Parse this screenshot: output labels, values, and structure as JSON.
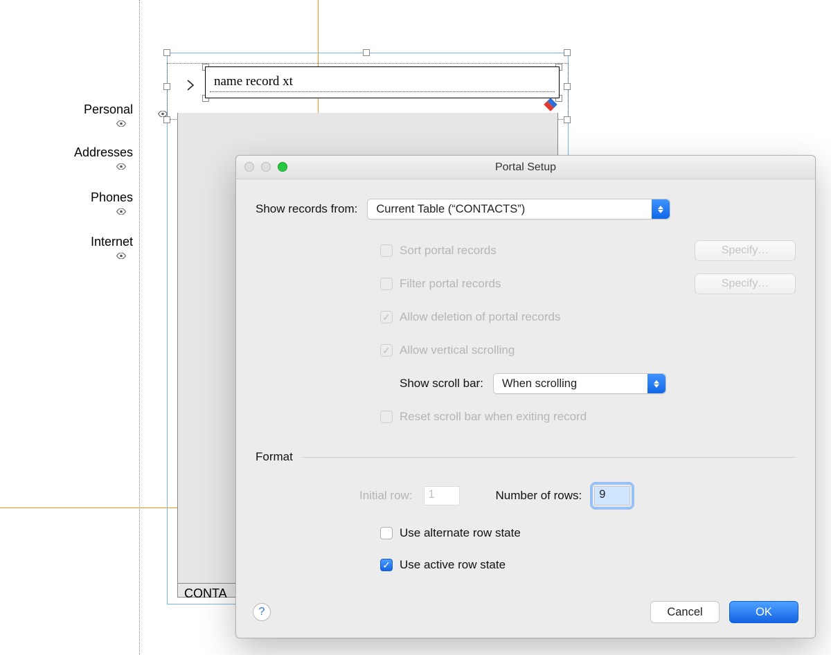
{
  "sidebar": {
    "items": [
      {
        "label": "Personal"
      },
      {
        "label": "Addresses"
      },
      {
        "label": "Phones"
      },
      {
        "label": "Internet"
      }
    ]
  },
  "layout": {
    "field_label": "name record xt",
    "portal_footer": "CONTA"
  },
  "dialog": {
    "title": "Portal Setup",
    "show_records_label": "Show records from:",
    "show_records_value": "Current Table (“CONTACTS”)",
    "sort_label": "Sort portal records",
    "filter_label": "Filter portal records",
    "allow_delete_label": "Allow deletion of portal records",
    "allow_scroll_label": "Allow vertical scrolling",
    "scrollbar_label": "Show scroll bar:",
    "scrollbar_value": "When scrolling",
    "reset_label": "Reset scroll bar when exiting record",
    "specify_label": "Specify…",
    "format_header": "Format",
    "initial_row_label": "Initial row:",
    "initial_row_value": "1",
    "num_rows_label": "Number of rows:",
    "num_rows_value": "9",
    "alt_row_label": "Use alternate row state",
    "active_row_label": "Use active row state",
    "cancel": "Cancel",
    "ok": "OK",
    "help": "?"
  }
}
